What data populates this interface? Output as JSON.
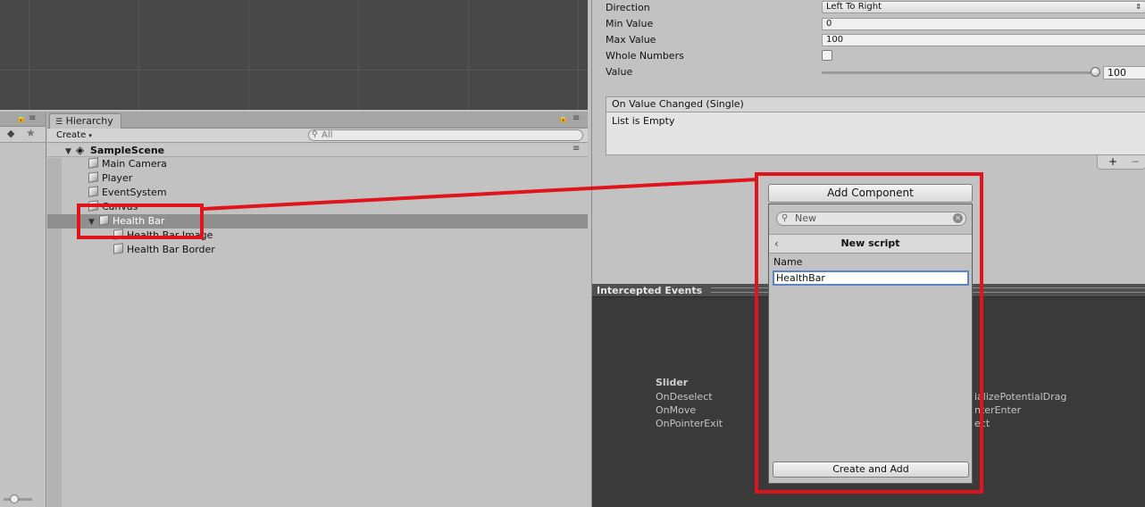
{
  "hierarchy": {
    "tab_label": "Hierarchy",
    "create_label": "Create",
    "search_placeholder": "All",
    "scene_name": "SampleScene",
    "items": [
      {
        "label": "Main Camera"
      },
      {
        "label": "Player"
      },
      {
        "label": "EventSystem"
      },
      {
        "label": "Canvas"
      },
      {
        "label": "Health Bar"
      },
      {
        "label": "Health Bar Image"
      },
      {
        "label": "Health Bar Border"
      }
    ]
  },
  "inspector": {
    "direction_label": "Direction",
    "direction_value": "Left To Right",
    "min_label": "Min Value",
    "min_value": "0",
    "max_label": "Max Value",
    "max_value": "100",
    "whole_numbers_label": "Whole Numbers",
    "whole_numbers_checked": false,
    "value_label": "Value",
    "value": "100",
    "value_fraction": 1.0,
    "event_header": "On Value Changed (Single)",
    "event_body": "List is Empty",
    "plus": "+",
    "minus": "−"
  },
  "add_component": {
    "button_label": "Add Component",
    "search_value": "New",
    "header": "New script",
    "name_label": "Name",
    "name_value": "HealthBar",
    "create_button": "Create and Add"
  },
  "events_panel": {
    "title": "Intercepted Events",
    "slider_heading": "Slider",
    "left_items": [
      "OnDeselect",
      "OnMove",
      "OnPointerExit"
    ],
    "right_items": [
      "ializePotentialDrag",
      "nterEnter",
      "ect"
    ]
  },
  "colors": {
    "annotation_red": "#e0141c",
    "selection_gray": "#8f8f8f",
    "focus_blue": "#5b84c4"
  }
}
